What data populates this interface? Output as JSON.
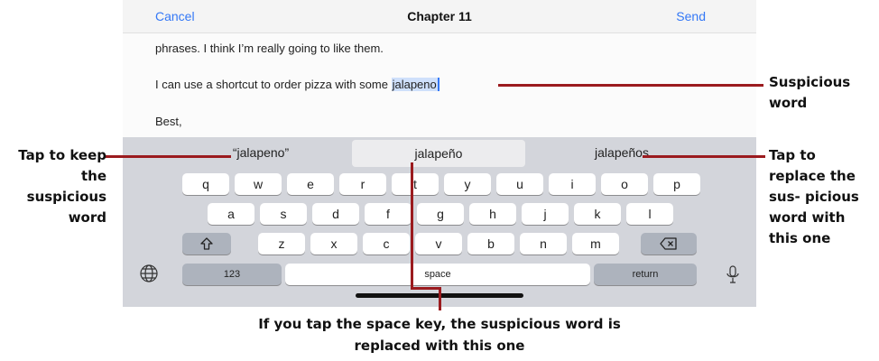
{
  "navbar": {
    "cancel": "Cancel",
    "title": "Chapter 11",
    "send": "Send"
  },
  "message": {
    "line1": "phrases. I think I’m really going to like them.",
    "line2_prefix": "I can use a shortcut to order pizza with some ",
    "line2_selected": "jalapeno",
    "line3": "Best,"
  },
  "suggestions": [
    "“jalapeno”",
    "jalapeño",
    "jalapeños"
  ],
  "keyboard": {
    "row1": [
      "q",
      "w",
      "e",
      "r",
      "t",
      "y",
      "u",
      "i",
      "o",
      "p"
    ],
    "row2": [
      "a",
      "s",
      "d",
      "f",
      "g",
      "h",
      "j",
      "k",
      "l"
    ],
    "row3": [
      "z",
      "x",
      "c",
      "v",
      "b",
      "n",
      "m"
    ],
    "numbers": "123",
    "space": "space",
    "return": "return"
  },
  "icons": {
    "shift": "shift-icon",
    "delete": "delete-backspace-icon",
    "globe": "globe-icon",
    "mic": "microphone-icon"
  },
  "callouts": {
    "left_keep": "Tap to keep the suspicious word",
    "right_suspicious": "Suspicious word",
    "right_replace": "Tap to replace the sus- picious word with this one",
    "bottom_space": "If you tap the space key, the suspicious word is replaced with this one"
  },
  "colors": {
    "callout_line": "#9b1b1f",
    "ios_blue": "#3478f6",
    "selection": "#cfe0fb"
  }
}
